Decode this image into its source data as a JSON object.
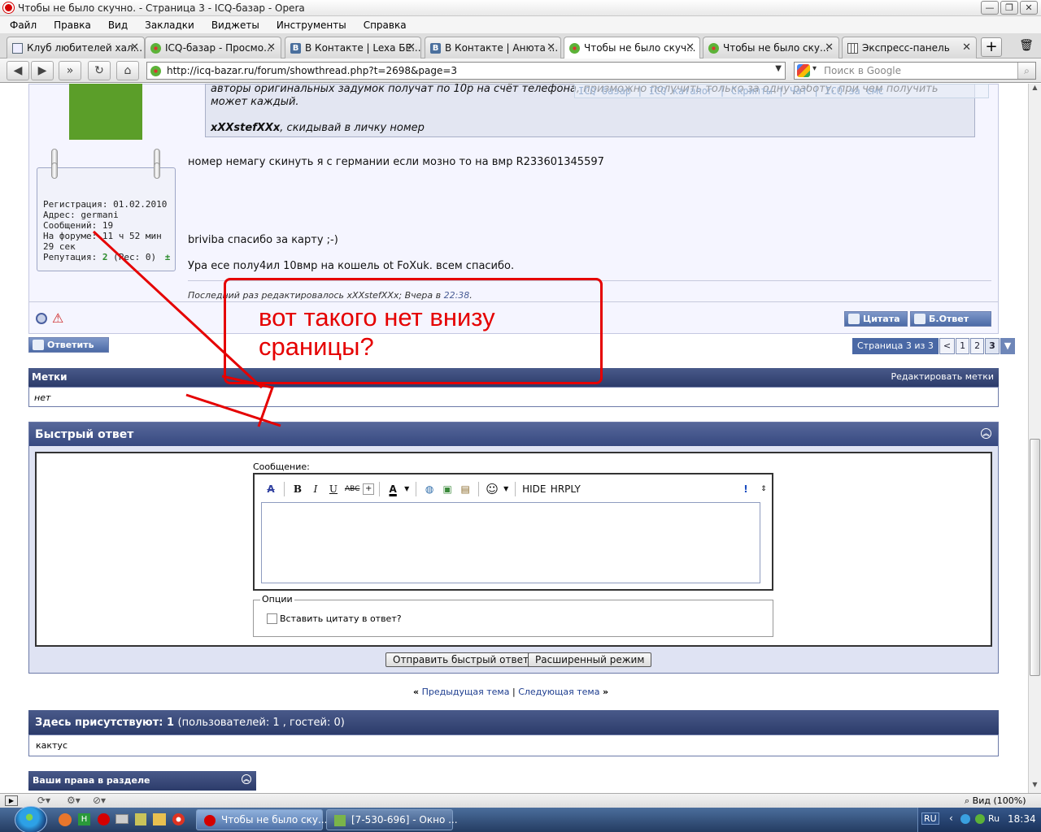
{
  "window": {
    "title": "Чтобы не было скучно. - Страница 3 - ICQ-базар - Opera",
    "controls": [
      "—",
      "❐",
      "✕"
    ]
  },
  "menu": [
    "Файл",
    "Правка",
    "Вид",
    "Закладки",
    "Виджеты",
    "Инструменты",
    "Справка"
  ],
  "tabs": [
    {
      "label": "Клуб любителей хал...",
      "icon": "document-icon"
    },
    {
      "label": "ICQ-базар - Просмо...",
      "icon": "icq-icon"
    },
    {
      "label": "В Контакте | Lexa БЕ...",
      "icon": "vk-icon"
    },
    {
      "label": "В Контакте | Анюта ...",
      "icon": "vk-icon"
    },
    {
      "label": "Чтобы не было скуч...",
      "icon": "icq-icon",
      "active": true
    },
    {
      "label": "Чтобы не было ску...",
      "icon": "icq-icon"
    },
    {
      "label": "Экспресс-панель",
      "icon": "speed-dial-icon"
    }
  ],
  "address": {
    "url": "http://icq-bazar.ru/forum/showthread.php?t=2698&page=3",
    "search_placeholder": "Поиск в Google"
  },
  "post": {
    "quote_lines": [
      "авторы оригинальных задумок получат по 10р на счёт телефона, призможно получить только за одну работу, при чём получить",
      "может каждый.",
      "xXXstefXXx, скидывай в личку номер"
    ],
    "quote_bold_name": "xXXstefXXx",
    "quote_tail": ", скидывай в личку номер",
    "watermark": "ICQ базар | ICQ каталог | Скрипты | Чат | ICQ за смс",
    "profile": {
      "registration": "Регистрация: 01.02.2010",
      "address": "Адрес: germani",
      "messages": "Сообщений: 19",
      "online": "На форуме: 11 ч 52 мин",
      "online2": "29 сек",
      "rep_label": "Репутация:",
      "rep_value": "2",
      "rep_extra": "(Рес: 0)"
    },
    "line1": "номер немагу скинуть я с германии если мозно то на вмр R233601345597",
    "line2": "briviba спасибо за карту ;-)",
    "line3": "Ура есе полу4ил 10вмр на кошель ot FoXuk. всем спасибо.",
    "edit_prefix": "Последний раз редактировалось xXXstefXXx; Вчера в ",
    "edit_time": "22:38",
    "edit_suffix": ".",
    "quote_btn": "Цитата",
    "fastreply_btn": "Б.Ответ"
  },
  "reply_btn": "Ответить",
  "pagination": {
    "label": "Страница 3 из 3",
    "prev": "<",
    "pages": [
      "1",
      "2",
      "3"
    ],
    "current": "3",
    "menu": "▼"
  },
  "tags": {
    "title": "Метки",
    "edit": "Редактировать метки",
    "value": "нет"
  },
  "annotation": {
    "line1": "вот такого нет внизу",
    "line2": "сраницы?"
  },
  "quick_reply": {
    "title": "Быстрый ответ",
    "message_label": "Сообщение:",
    "toolbar": [
      "B",
      "I",
      "U",
      "ABC",
      "HIDE",
      "HRPLY"
    ],
    "options_label": "Опции",
    "insert_quote": "Вставить цитату в ответ?",
    "submit": "Отправить быстрый ответ",
    "advanced": "Расширенный режим"
  },
  "thread_nav": {
    "prev_arrows": "«",
    "prev": "Предыдущая тема",
    "sep": "|",
    "next": "Следующая тема",
    "next_arrows": "»"
  },
  "present": {
    "title": "Здесь присутствуют: 1",
    "detail": "(пользователей: 1 , гостей: 0)",
    "users": "кактус"
  },
  "rights": {
    "title": "Ваши права в разделе"
  },
  "status": {
    "zoom": "Вид (100%)"
  },
  "taskbar": {
    "tasks": [
      "Чтобы не было ску...",
      "[7-530-696] - Окно ..."
    ],
    "lang": "RU",
    "time": "18:34"
  },
  "colors": {
    "annotation": "#e50000",
    "forum_header": "#364880"
  }
}
